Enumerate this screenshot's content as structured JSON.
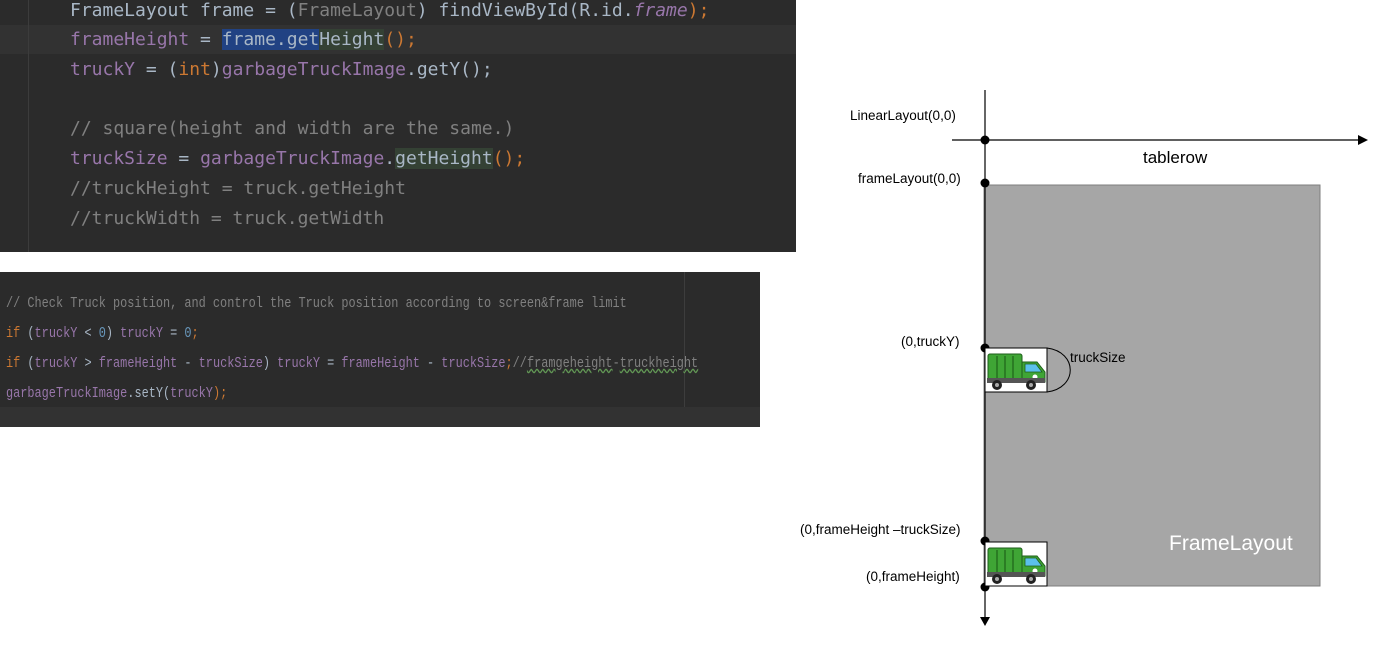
{
  "editor_top": {
    "line_1": {
      "a": "FrameLayout frame = (",
      "b": "FrameLayout",
      "c": ") findViewById(R.id.",
      "d": "frame",
      "e": ");"
    },
    "line_2": {
      "a": "frameHeight",
      "b": " = ",
      "c": "frame.get",
      "d": "Height",
      "e": "();"
    },
    "line_3": {
      "a": "truckY",
      "b": " = (",
      "c": "int",
      "d": ")",
      "e": "garbageTruckImage",
      "f": ".getY();"
    },
    "line_5": "// square(height and width are the same.)",
    "line_6": {
      "a": "truckSize",
      "b": " = ",
      "c": "garbageTruckImage",
      "d": ".",
      "e": "getHeight",
      "f": "();"
    },
    "line_7": "//truckHeight = truck.getHeight",
    "line_8": "//truckWidth = truck.getWidth"
  },
  "editor_bottom": {
    "line_1": "// Check Truck position, and control the Truck position according to screen&frame limit",
    "line_2": {
      "kw": "if",
      "a": " (",
      "b": "truckY",
      "c": " < ",
      "d": "0",
      "e": ") ",
      "f": "truckY",
      "g": " = ",
      "h": "0",
      "i": ";"
    },
    "line_3": {
      "kw": "if",
      "a": " (",
      "b": "truckY",
      "c": " > ",
      "d": "frameHeight",
      "e": " - ",
      "f": "truckSize",
      "g": ") ",
      "h": "truckY",
      "i": " = ",
      "j": "frameHeight",
      "k": " - ",
      "l": "truckSize",
      "m": ";",
      "n": "//",
      "o": "framgeheight",
      "p": "-",
      "q": "truckheight"
    },
    "line_4": {
      "a": "garbageTruckImage",
      "b": ".setY(",
      "c": "truckY",
      "d": ");"
    }
  },
  "diagram": {
    "labels": {
      "linear_layout": "LinearLayout(0,0)",
      "tablerow": "tablerow",
      "frame_layout_origin": "frameLayout(0,0)",
      "truck_y": "(0,truckY)",
      "truck_size": "truckSize",
      "frame_height_minus_truck": "(0,frameHeight –truckSize)",
      "frame_height": "(0,frameHeight)",
      "frame_layout": "FrameLayout"
    },
    "colors": {
      "frame_fill": "#a6a6a6",
      "truck_body": "#3fa535",
      "truck_window": "#5bc0eb"
    }
  }
}
